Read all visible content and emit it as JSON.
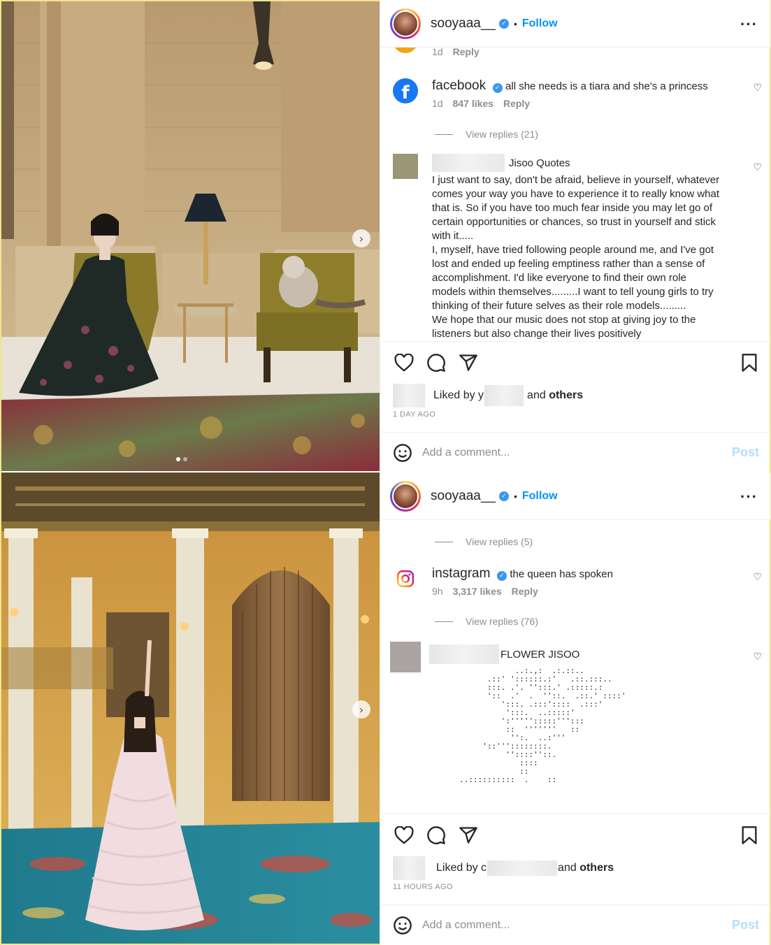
{
  "posts": [
    {
      "header": {
        "username": "sooyaaa__",
        "separator": "•",
        "follow": "Follow"
      },
      "partial_meta": {
        "time": "1d",
        "reply": "Reply"
      },
      "comments": [
        {
          "name": "facebook",
          "text": "all she needs is a tiara and she's a princess",
          "time": "1d",
          "likes": "847 likes",
          "reply": "Reply",
          "view_replies": "View replies (21)"
        }
      ],
      "long_comment": {
        "name_suffix": "Jisoo Quotes",
        "text": "I just want to say, don't be afraid, believe in yourself, whatever\ncomes your way you have to experience it to really know what\nthat is. So if you have too much fear inside you may let go of\ncertain opportunities or chances, so trust in yourself and stick\nwith it.....\nI, myself, have tried following people around me, and I've got\nlost and ended up feeling emptiness rather than a sense of\naccomplishment. I'd like everyone to find their own role\nmodels within themselves.........I want to tell young girls to try\nthinking of their future selves as their role models.........\nWe hope that our music does not stop at giving joy to the\nlisteners but also change their lives positively"
      },
      "liked": {
        "prefix": "Liked by y",
        "and": "and",
        "others": "others"
      },
      "time_ago": "1 DAY AGO",
      "add_comment": {
        "placeholder": "Add a comment...",
        "post": "Post"
      }
    },
    {
      "header": {
        "username": "sooyaaa__",
        "separator": "•",
        "follow": "Follow"
      },
      "view_replies_top": "View replies (5)",
      "comments": [
        {
          "name": "instagram",
          "text": "the queen has spoken",
          "time": "9h",
          "likes": "3,317 likes",
          "reply": "Reply",
          "view_replies": "View replies (76)"
        }
      ],
      "ascii_comment": {
        "name_suffix": "FLOWER JISOO",
        "art": "                 ..:.,:  .:.::..\n           .::' '::::::.:'   .::.:::..\n           :::. .'. '':::.' .:::::.:\n           '::  .'  .  ''::.  .::.' ::::'\n              ':::. .:::'::::  .:::'\n               ':::.  ..:::::'\n              ':''''':::::''':::\n               ::  '''''''   ::\n                '':.  ..:'''\n          '::'''::::::::.\n               ''::::''::.\n                  ::::\n                  ::\n     ..::::::::::  .    ::"
      },
      "liked": {
        "prefix": "Liked by c",
        "and": "and",
        "others": "others"
      },
      "time_ago": "11 HOURS AGO",
      "add_comment": {
        "placeholder": "Add a comment...",
        "post": "Post"
      }
    }
  ],
  "icons": {
    "like": "heart-icon",
    "comment": "speech-bubble-icon",
    "share": "paper-plane-icon",
    "save": "bookmark-icon",
    "emoji": "smiley-icon",
    "more": "more-options-icon",
    "verified": "verified-badge-icon",
    "next": "chevron-right-icon"
  },
  "colors": {
    "link": "#0095f6",
    "muted": "#8e8e8e",
    "post_disabled": "#b2dffc",
    "facebook": "#1877f2"
  }
}
